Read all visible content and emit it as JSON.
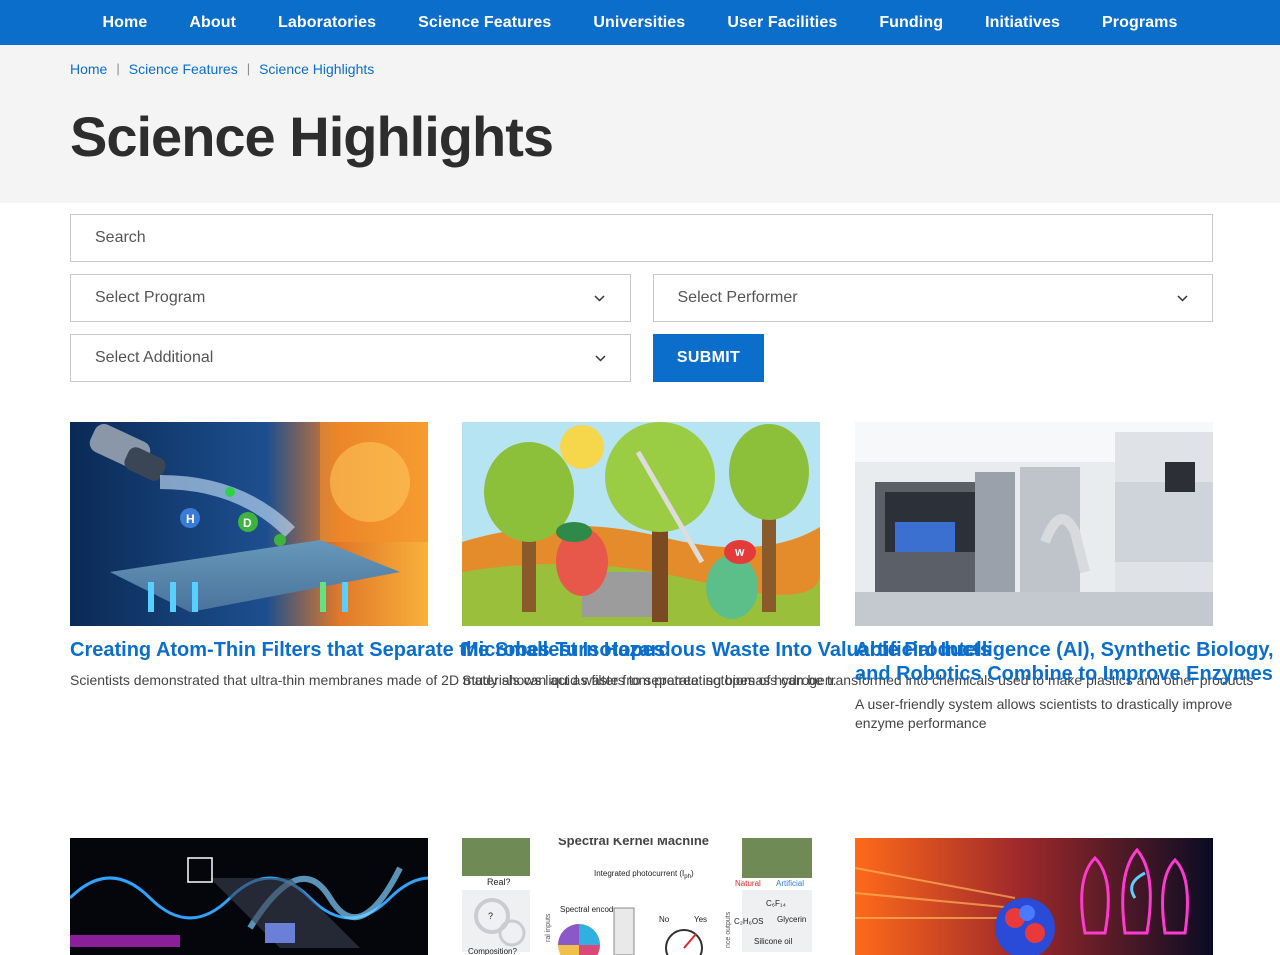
{
  "nav": {
    "items": [
      "Home",
      "About",
      "Laboratories",
      "Science Features",
      "Universities",
      "User Facilities",
      "Funding",
      "Initiatives",
      "Programs"
    ]
  },
  "breadcrumb": {
    "items": [
      "Home",
      "Science Features",
      "Science Highlights"
    ]
  },
  "page": {
    "title": "Science Highlights"
  },
  "filters": {
    "search_placeholder": "Search",
    "program": "Select Program",
    "performer": "Select Performer",
    "additional": "Select Additional",
    "submit_label": "SUBMIT"
  },
  "cards": [
    {
      "title": "Creating Atom-Thin Filters that Separate the Smallest Isotopes",
      "summary": "Scientists demonstrated that ultra-thin membranes made of 2D materials can act as filters to separate isotopes of hydrogen.",
      "image_text_h": "H",
      "image_text_d": "D"
    },
    {
      "title": "Microbes Turn Hazardous Waste Into Valuable Products",
      "summary": "Study shows liquid waste from pretreating biomass can be transformed into chemicals used to make plastics and other products",
      "image_text_w": "W"
    },
    {
      "title": "Artificial Intelligence (AI), Synthetic Biology, and Robotics Combine to Improve Enzymes",
      "summary": "A user-friendly system allows scientists to drastically improve enzyme performance"
    }
  ],
  "cards_row2": [
    {},
    {
      "image_title": "Spectral Kernel Machine",
      "image_labels": {
        "real": "Real?",
        "spectral_encoder": "Spectral encoder",
        "integrated_photocurrent": "Integrated photocurrent (I",
        "photocurrent_sub": "ph",
        "no": "No",
        "yes": "Yes",
        "natural": "Natural",
        "artificial": "Artificial",
        "c6f14": "C₆F₁₄",
        "c2h6os": "C₂H₆OS",
        "glycerin": "Glycerin",
        "silicone_oil": "Silicone oil",
        "composition": "Composition?",
        "question": "?",
        "side_left": "ral inputs",
        "side_right": "nce outputs"
      }
    },
    {}
  ]
}
